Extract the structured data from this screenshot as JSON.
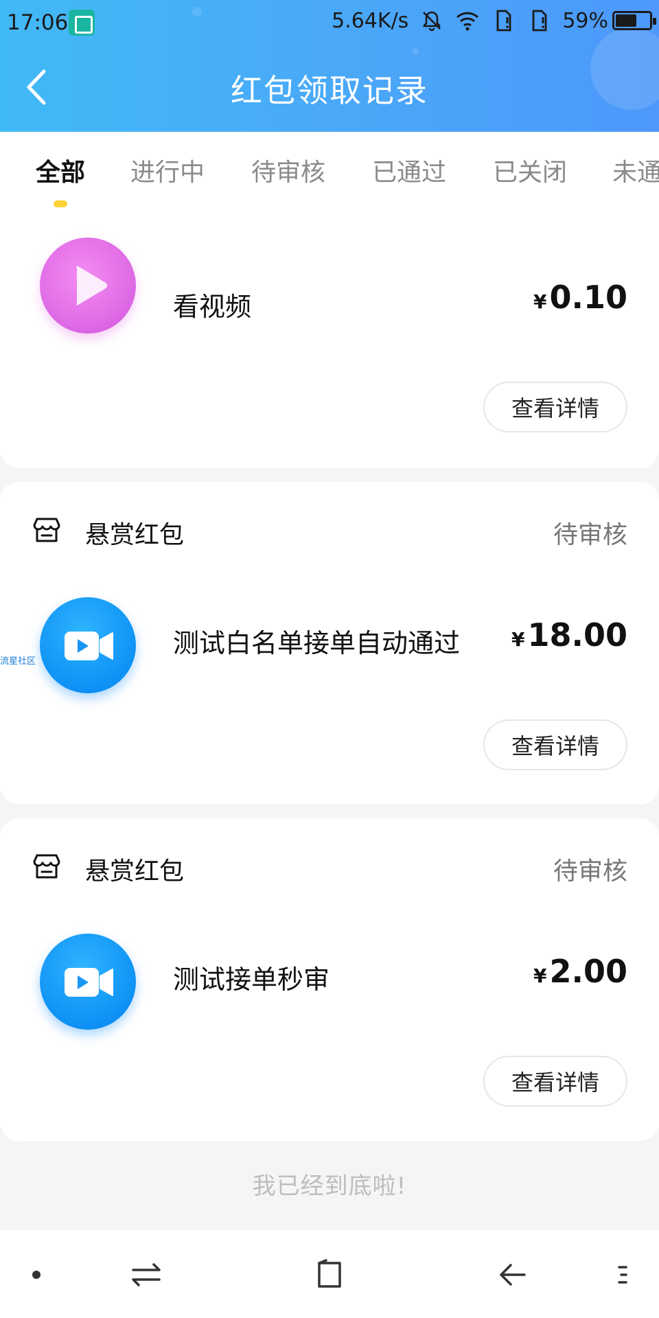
{
  "status_bar": {
    "time": "17:06",
    "network_speed": "5.64K/s",
    "battery": "59%"
  },
  "header": {
    "title": "红包领取记录"
  },
  "tabs": [
    {
      "label": "全部",
      "active": true
    },
    {
      "label": "进行中",
      "active": false
    },
    {
      "label": "待审核",
      "active": false
    },
    {
      "label": "已通过",
      "active": false
    },
    {
      "label": "已关闭",
      "active": false
    },
    {
      "label": "未通过",
      "active": false
    }
  ],
  "records": [
    {
      "category": "",
      "status": "",
      "icon": "play-icon",
      "name": "看视频",
      "currency": "¥",
      "amount": "0.10",
      "detail_label": "查看详情"
    },
    {
      "category": "悬赏红包",
      "status": "待审核",
      "icon": "video-camera-icon",
      "name": "测试白名单接单自动通过",
      "currency": "¥",
      "amount": "18.00",
      "detail_label": "查看详情"
    },
    {
      "category": "悬赏红包",
      "status": "待审核",
      "icon": "video-camera-icon",
      "name": "测试接单秒审",
      "currency": "¥",
      "amount": "2.00",
      "detail_label": "查看详情"
    }
  ],
  "watermark": "流星社区",
  "footer_note": "我已经到底啦!",
  "colors": {
    "header_gradient_start": "#41b9f6",
    "header_gradient_end": "#4d98fa",
    "tab_indicator": "#ffd234",
    "price_text": "#111111"
  }
}
